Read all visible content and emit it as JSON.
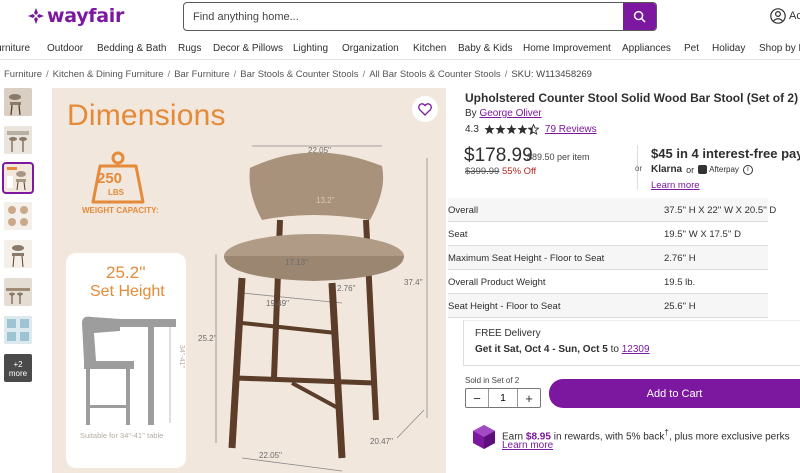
{
  "header": {
    "logo_text": "wayfair",
    "search_placeholder": "Find anything home...",
    "account_label": "Ac"
  },
  "categories": [
    "Furniture",
    "Outdoor",
    "Bedding & Bath",
    "Rugs",
    "Decor & Pillows",
    "Lighting",
    "Organization",
    "Kitchen",
    "Baby & Kids",
    "Home Improvement",
    "Appliances",
    "Pet",
    "Holiday",
    "Shop by R"
  ],
  "breadcrumb": {
    "items": [
      "Furniture",
      "Kitchen & Dining Furniture",
      "Bar Furniture",
      "Bar Stools & Counter Stools",
      "All Bar Stools & Counter Stools"
    ],
    "sku": "SKU: W113458269"
  },
  "thumbnails": {
    "more_count": "+2",
    "more_label": "more"
  },
  "image": {
    "heading": "Dimensions",
    "weight_value": "250",
    "weight_unit": "LBS",
    "weight_caption": "WEIGHT CAPACITY:",
    "set_height_value": "25.2''",
    "set_height_label": "Set Height",
    "suitable": "Suitable for 34''-41'' table",
    "small_range": "34''-41''",
    "dims": {
      "top_width": "22.05''",
      "back_height": "13.2''",
      "seat_width": "17.13''",
      "seat_depth": "19.49''",
      "seat_thick": "2.76''",
      "total_height": "37.4''",
      "seat_height": "25.2''",
      "base_width": "22.05''",
      "base_depth": "20.47''"
    }
  },
  "product": {
    "title": "Upholstered Counter Stool Solid Wood Bar Stool (Set of 2)",
    "by_prefix": "By",
    "brand": "George Oliver",
    "rating": "4.3",
    "rating_value": 4.3,
    "reviews": "79 Reviews",
    "price": "$178.99",
    "unit_price": "$89.50 per item",
    "was_price": "$399.99",
    "discount": "55% Off",
    "or_label": "or",
    "installment_amount": "$45",
    "installment_rest": "in 4 interest-free paym",
    "klarna": "Klarna",
    "klarna_or": "or",
    "afterpay": "Afterpay",
    "learn_more": "Learn more"
  },
  "specs": [
    {
      "label": "Overall",
      "value": "37.5'' H X 22'' W X 20.5'' D"
    },
    {
      "label": "Seat",
      "value": "19.5'' W X 17.5'' D"
    },
    {
      "label": "Maximum Seat Height - Floor to Seat",
      "value": "2.76'' H"
    },
    {
      "label": "Overall Product Weight",
      "value": "19.5 lb."
    },
    {
      "label": "Seat Height - Floor to Seat",
      "value": "25.6'' H"
    }
  ],
  "delivery": {
    "free": "FREE Delivery",
    "get_it": "Get it Sat, Oct 4 - Sun, Oct 5",
    "to": "to",
    "zip": "12309"
  },
  "cart": {
    "sold_in": "Sold in Set of 2",
    "quantity": "1",
    "minus": "−",
    "plus": "+",
    "add_label": "Add to Cart"
  },
  "rewards": {
    "earn": "Earn",
    "amount": "$8.95",
    "rest": "in rewards, with 5% back",
    "sup": "†",
    "tail": ", plus more exclusive perks",
    "learn_more": "Learn more"
  },
  "colors": {
    "brand": "#7b189f",
    "accent_orange": "#e48a39",
    "sale_red": "#b3261e",
    "image_bg": "#f2e7dd"
  }
}
